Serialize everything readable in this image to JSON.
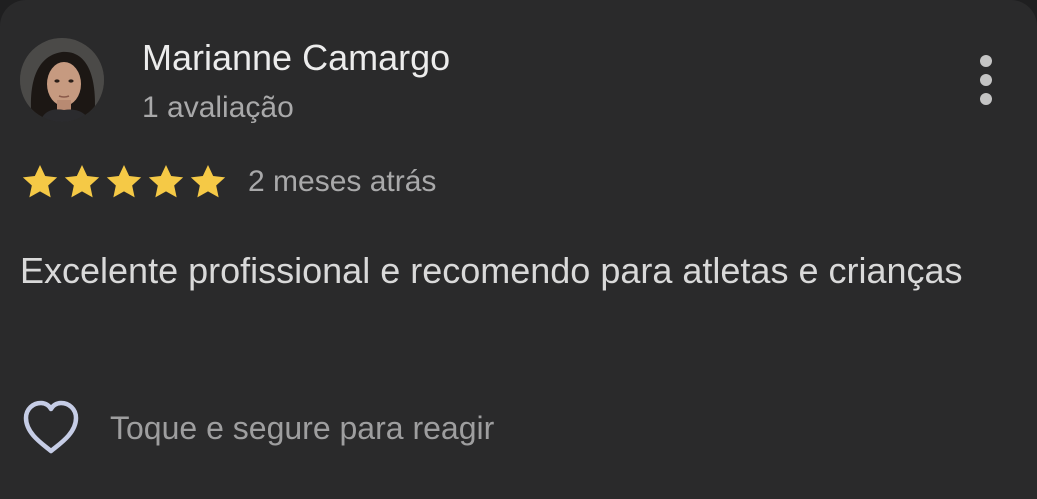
{
  "review": {
    "reviewer_name": "Marianne Camargo",
    "review_count": "1 avaliação",
    "rating": 5,
    "rating_max": 5,
    "time_ago": "2 meses atrás",
    "text": "Excelente profissional e recomendo para atletas e crianças",
    "react_hint": "Toque e segure para reagir"
  },
  "icons": {
    "avatar": "avatar-photo",
    "more": "more-vert-icon",
    "star": "star-icon",
    "heart": "heart-outline-icon"
  },
  "colors": {
    "background": "#2a2a2b",
    "star": "#f5c946",
    "primary_text": "#ececec",
    "secondary_text": "#a9a9aa"
  }
}
